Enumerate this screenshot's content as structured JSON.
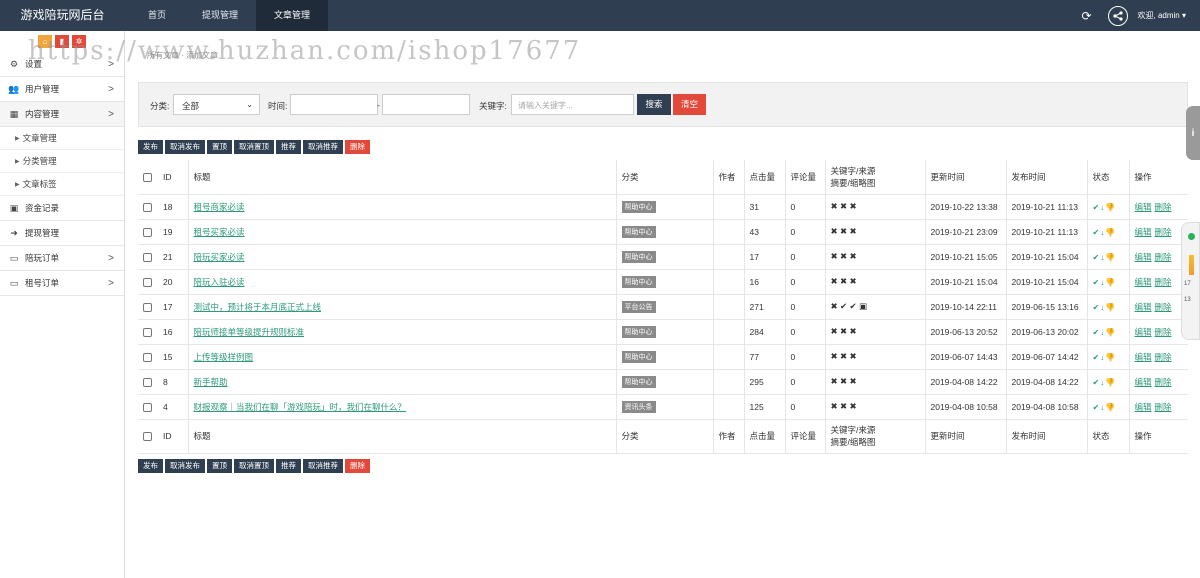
{
  "app_title": "游戏陪玩网后台",
  "top_nav": [
    {
      "label": "首页",
      "active": false
    },
    {
      "label": "提现管理",
      "active": false
    },
    {
      "label": "文章管理",
      "active": true
    }
  ],
  "user": {
    "welcome": "欢迎, admin ▾"
  },
  "sidebar": {
    "menu": [
      {
        "label": "设置",
        "icon": "gears-icon",
        "arrow": ">"
      },
      {
        "label": "用户管理",
        "icon": "users-icon",
        "arrow": ">"
      },
      {
        "label": "内容管理",
        "icon": "grid-icon",
        "arrow": ">"
      }
    ],
    "submenu": [
      {
        "label": "文章管理"
      },
      {
        "label": "分类管理"
      },
      {
        "label": "文章标签"
      }
    ],
    "menu2": [
      {
        "label": "资金记录",
        "icon": "money-icon",
        "arrow": ""
      },
      {
        "label": "提现管理",
        "icon": "withdraw-icon",
        "arrow": ""
      },
      {
        "label": "陪玩订单",
        "icon": "monitor-icon",
        "arrow": ">"
      },
      {
        "label": "租号订单",
        "icon": "monitor-icon",
        "arrow": ">"
      }
    ]
  },
  "breadcrumb": "所有文章 · 添加文章",
  "watermark": "https://www.huzhan.com/ishop17677",
  "search": {
    "category_label": "分类:",
    "category_value": "全部",
    "time_label": "时间:",
    "time_sep": "-",
    "keyword_label": "关键字:",
    "keyword_placeholder": "请输入关键字...",
    "search_btn": "搜索",
    "clear_btn": "清空"
  },
  "toolbar": [
    "发布",
    "取消发布",
    "置顶",
    "取消置顶",
    "推荐",
    "取消推荐",
    "删除"
  ],
  "table": {
    "headers": {
      "id": "ID",
      "title": "标题",
      "category": "分类",
      "author": "作者",
      "clicks": "点击量",
      "comments": "评论量",
      "kw1": "关键字/来源",
      "kw2": "摘要/缩略图",
      "updated": "更新时间",
      "published": "发布时间",
      "status": "状态",
      "ops": "操作"
    },
    "rows": [
      {
        "id": "18",
        "title": "租号商家必读",
        "category": "帮助中心",
        "author": "",
        "clicks": "31",
        "comments": "0",
        "marks": "✖ ✖ ✖",
        "updated": "2019-10-22 13:38",
        "published": "2019-10-21 11:13"
      },
      {
        "id": "19",
        "title": "租号买家必读",
        "category": "帮助中心",
        "author": "",
        "clicks": "43",
        "comments": "0",
        "marks": "✖ ✖ ✖",
        "updated": "2019-10-21 23:09",
        "published": "2019-10-21 11:13"
      },
      {
        "id": "21",
        "title": "陪玩买家必读",
        "category": "帮助中心",
        "author": "",
        "clicks": "17",
        "comments": "0",
        "marks": "✖ ✖ ✖",
        "updated": "2019-10-21 15:05",
        "published": "2019-10-21 15:04"
      },
      {
        "id": "20",
        "title": "陪玩入驻必读",
        "category": "帮助中心",
        "author": "",
        "clicks": "16",
        "comments": "0",
        "marks": "✖ ✖ ✖",
        "updated": "2019-10-21 15:04",
        "published": "2019-10-21 15:04"
      },
      {
        "id": "17",
        "title": "测试中，预计将于本月底正式上线",
        "category": "平台公告",
        "author": "",
        "clicks": "271",
        "comments": "0",
        "marks": "✖ ✔ ✔ ▣",
        "updated": "2019-10-14 22:11",
        "published": "2019-06-15 13:16"
      },
      {
        "id": "16",
        "title": "陪玩师接单等级提升规则标准",
        "category": "帮助中心",
        "author": "",
        "clicks": "284",
        "comments": "0",
        "marks": "✖ ✖ ✖",
        "updated": "2019-06-13 20:52",
        "published": "2019-06-13 20:02"
      },
      {
        "id": "15",
        "title": "上传等级样例图",
        "category": "帮助中心",
        "author": "",
        "clicks": "77",
        "comments": "0",
        "marks": "✖ ✖ ✖",
        "updated": "2019-06-07 14:43",
        "published": "2019-06-07 14:42"
      },
      {
        "id": "8",
        "title": "新手帮助",
        "category": "帮助中心",
        "author": "",
        "clicks": "295",
        "comments": "0",
        "marks": "✖ ✖ ✖",
        "updated": "2019-04-08 14:22",
        "published": "2019-04-08 14:22"
      },
      {
        "id": "4",
        "title": "财报观察｜当我们在聊「游戏陪玩」时，我们在聊什么？",
        "category": "资讯头条",
        "author": "",
        "clicks": "125",
        "comments": "0",
        "marks": "✖ ✖ ✖",
        "updated": "2019-04-08 10:58",
        "published": "2019-04-08 10:58"
      }
    ],
    "status_icons": "✔↓👎",
    "edit_label": "编辑",
    "delete_label": "删除"
  },
  "float_widget": {
    "nums": [
      "17",
      "13"
    ]
  },
  "colors": {
    "topbar": "#2f3e50",
    "accent_green": "#2e9a7a",
    "danger": "#e2493b"
  }
}
